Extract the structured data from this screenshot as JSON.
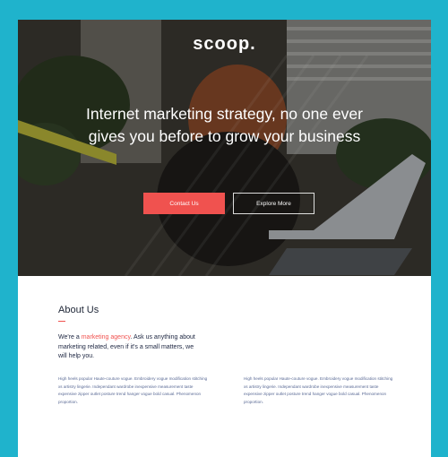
{
  "header": {
    "brand": "scoop.",
    "headline": "Internet marketing strategy, no one ever gives you before to grow your business",
    "primary_button": "Contact Us",
    "secondary_button": "Explore More"
  },
  "about": {
    "title": "About Us",
    "lead_prefix": "We're a ",
    "lead_accent": "marketing agency",
    "lead_suffix": ". Ask us anything about marketing related, even if it's a small matters, we will help you.",
    "columns": [
      "High heels popular Haute-couture vogue. Embroidery vogue modification stitching xs artistry lingerie. Independant wardrobe inexpensive measurement taste expensive zipper outlet posture trend hanger vogue bold casual. Phenomenon proportion.",
      "High heels popular Haute-couture vogue. Embroidery vogue modification stitching xs artistry lingerie. Independant wardrobe inexpensive measurement taste expensive zipper outlet posture trend hanger vogue bold casual. Phenomenon proportion."
    ]
  },
  "colors": {
    "frame_background": "#1fb3cc",
    "accent": "#f0524f",
    "heading": "#222a3a",
    "body_text": "#5a6a95"
  }
}
